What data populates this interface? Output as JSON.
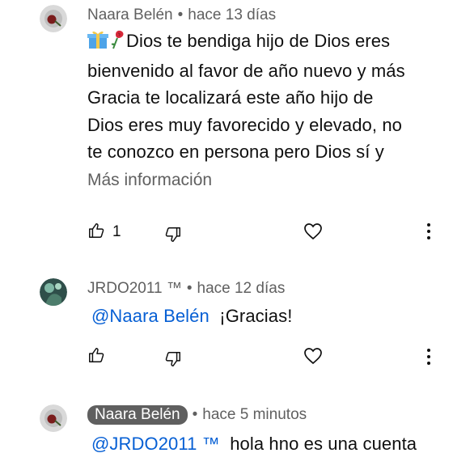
{
  "comments": [
    {
      "author": "Naara Belén",
      "time": "hace 13 días",
      "emoji_icons": [
        "gift-emoji-icon",
        "rose-emoji-icon"
      ],
      "text_lines": [
        "Dios te bendiga hijo de Dios eres",
        "bienvenido al favor de año nuevo y más",
        "Gracia te localizará este año hijo de",
        "Dios eres muy favorecido y elevado, no",
        "te conozco en persona pero Dios sí y"
      ],
      "more_label": "Más información",
      "likes": "1"
    },
    {
      "author": "JRDO2011 ™",
      "time": "hace 12 días",
      "mention": "@Naara Belén",
      "text": "¡Gracias!"
    },
    {
      "author": "Naara Belén",
      "time": "hace 5 minutos",
      "mention": "@JRDO2011 ™",
      "text": "hola hno es una cuenta"
    }
  ],
  "separator": "•",
  "colors": {
    "text": "#0f0f0f",
    "meta": "#606060",
    "mention": "#065fd4",
    "pill": "#5f5f5f"
  }
}
